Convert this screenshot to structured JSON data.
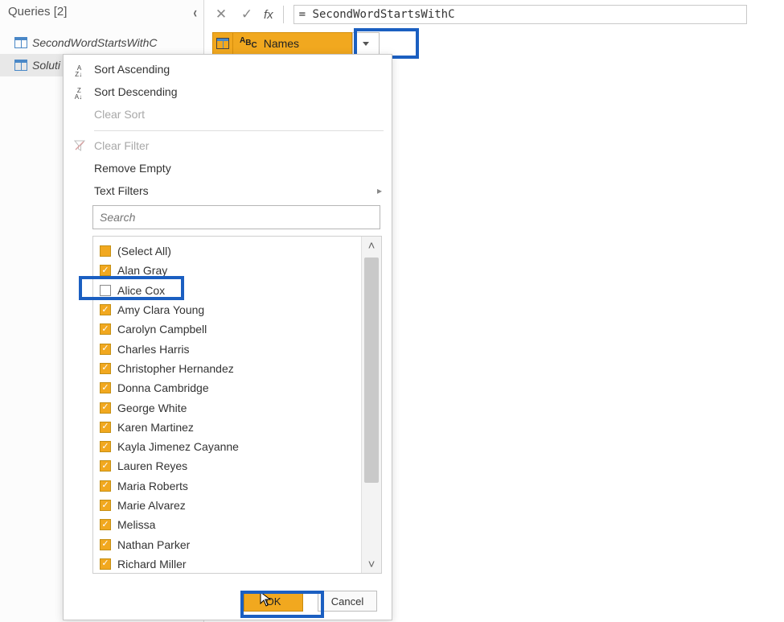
{
  "sidebar": {
    "title": "Queries [2]",
    "items": [
      {
        "label": "SecondWordStartsWithC"
      },
      {
        "label": "Soluti"
      }
    ]
  },
  "formula_bar": {
    "formula": "= SecondWordStartsWithC"
  },
  "column": {
    "name": "Names"
  },
  "filter_menu": {
    "sort_asc": "Sort Ascending",
    "sort_desc": "Sort Descending",
    "clear_sort": "Clear Sort",
    "clear_filter": "Clear Filter",
    "remove_empty": "Remove Empty",
    "text_filters": "Text Filters",
    "search_placeholder": "Search",
    "select_all": "(Select All)",
    "values": [
      {
        "label": "Alan Gray",
        "checked": true
      },
      {
        "label": "Alice Cox",
        "checked": false
      },
      {
        "label": "Amy Clara Young",
        "checked": true
      },
      {
        "label": "Carolyn Campbell",
        "checked": true
      },
      {
        "label": "Charles Harris",
        "checked": true
      },
      {
        "label": "Christopher Hernandez",
        "checked": true
      },
      {
        "label": "Donna Cambridge",
        "checked": true
      },
      {
        "label": "George White",
        "checked": true
      },
      {
        "label": "Karen Martinez",
        "checked": true
      },
      {
        "label": "Kayla Jimenez Cayanne",
        "checked": true
      },
      {
        "label": "Lauren Reyes",
        "checked": true
      },
      {
        "label": "Maria Roberts",
        "checked": true
      },
      {
        "label": "Marie Alvarez",
        "checked": true
      },
      {
        "label": "Melissa",
        "checked": true
      },
      {
        "label": "Nathan Parker",
        "checked": true
      },
      {
        "label": "Richard Miller",
        "checked": true
      }
    ],
    "ok": "OK",
    "cancel": "Cancel"
  }
}
